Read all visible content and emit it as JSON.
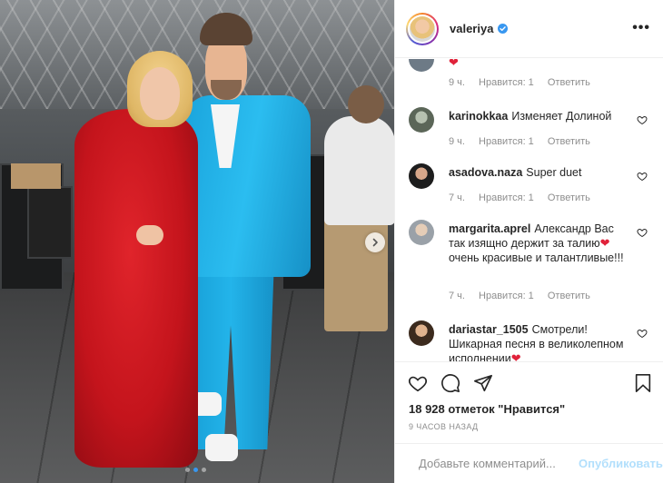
{
  "post": {
    "username": "valeriya",
    "more_label": "•••",
    "likes_label": "18 928 отметок \"Нравится\"",
    "time_ago": "9 ЧАСОВ НАЗАД"
  },
  "colors": {
    "link": "#3897f0",
    "heart": "#e0223a",
    "muted": "#8e8e8e",
    "publish_disabled": "#b2dffc"
  },
  "comments": [
    {
      "username": "",
      "text": "",
      "time": "9 ч.",
      "likes": "Нравится: 1",
      "reply": "Ответить",
      "has_heart_emoji": true
    },
    {
      "username": "karinokkaa",
      "text": "Изменяет Долиной",
      "time": "9 ч.",
      "likes": "Нравится: 1",
      "reply": "Ответить"
    },
    {
      "username": "asadova.naza",
      "text": "Super duet",
      "time": "7 ч.",
      "likes": "Нравится: 1",
      "reply": "Ответить"
    },
    {
      "username": "margarita.aprel",
      "text": "Александр Вас так изящно держит за талию",
      "text_tail": "очень красивые и талантливые!!!",
      "time": "7 ч.",
      "likes": "Нравится: 1",
      "reply": "Ответить"
    },
    {
      "username": "dariastar_1505",
      "text": "Смотрели! Шикарная песня в великолепном исполнении"
    }
  ],
  "add_comment": {
    "placeholder": "Добавьте комментарий...",
    "publish_label": "Опубликовать"
  },
  "icons": {
    "like": "heart-outline-icon",
    "comment": "comment-bubble-icon",
    "share": "paper-plane-icon",
    "save": "bookmark-icon",
    "emoji": "smiley-icon",
    "next": "chevron-right-icon",
    "verified": "verified-badge-icon"
  },
  "carousel": {
    "total": 3,
    "active": 1
  }
}
